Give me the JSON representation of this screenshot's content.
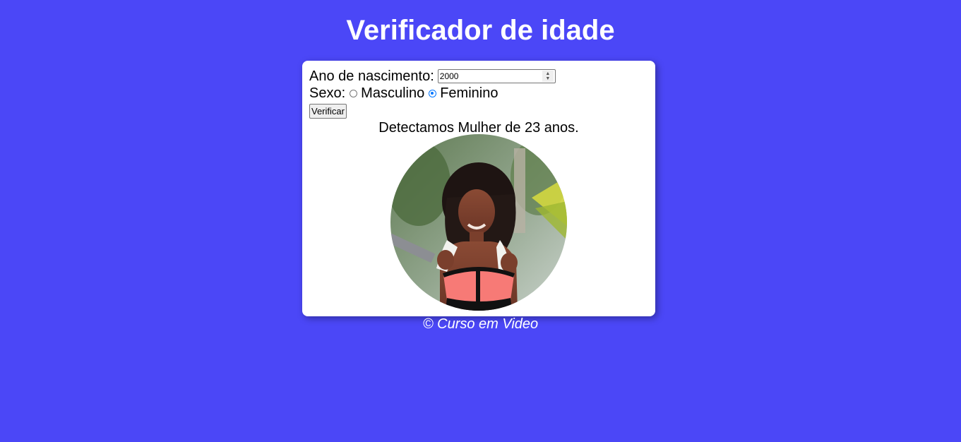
{
  "header": {
    "title": "Verificador de idade"
  },
  "form": {
    "birth_year_label": "Ano de nascimento:",
    "birth_year_value": "2000",
    "sex_label": "Sexo:",
    "options": [
      {
        "label": "Masculino",
        "checked": false
      },
      {
        "label": "Feminino",
        "checked": true
      }
    ],
    "verify_button": "Verificar"
  },
  "result": {
    "text": "Detectamos Mulher de 23 anos.",
    "photo_icon": "woman-photo"
  },
  "footer": {
    "text": "© Curso em Video"
  },
  "colors": {
    "background": "#4b47f7",
    "card": "#ffffff",
    "radio_accent": "#0075ff"
  }
}
